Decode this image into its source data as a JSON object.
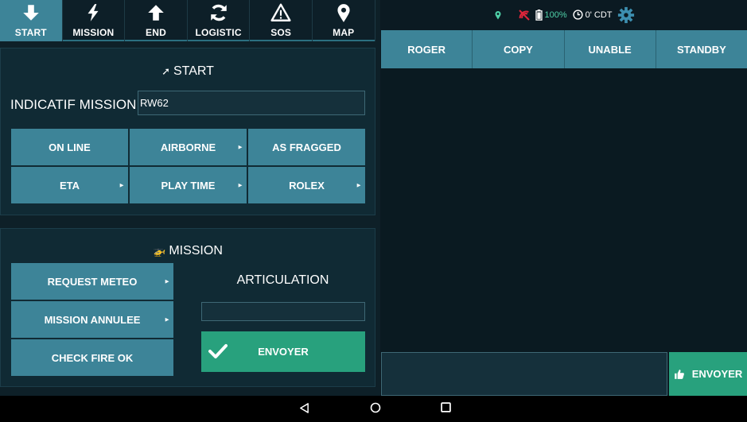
{
  "tabs": [
    {
      "label": "START",
      "icon": "arrow-down-icon"
    },
    {
      "label": "MISSION",
      "icon": "lightning-icon"
    },
    {
      "label": "END",
      "icon": "arrow-up-icon"
    },
    {
      "label": "LOGISTIC",
      "icon": "refresh-icon"
    },
    {
      "label": "SOS",
      "icon": "warning-icon"
    },
    {
      "label": "MAP",
      "icon": "map-pin-icon"
    }
  ],
  "active_tab": "START",
  "start": {
    "title": "START",
    "callsign_label": "INDICATIF MISSION",
    "callsign_value": "RW62",
    "buttons": [
      "ON LINE",
      "AIRBORNE",
      "AS FRAGGED",
      "ETA",
      "PLAY TIME",
      "ROLEX"
    ]
  },
  "mission": {
    "title": "MISSION",
    "buttons": [
      "REQUEST METEO",
      "MISSION ANNULEE",
      "CHECK FIRE OK"
    ],
    "articulation_label": "ARTICULATION",
    "articulation_value": "",
    "send_label": "ENVOYER"
  },
  "status": {
    "battery": "100%",
    "timer": "0'",
    "timezone": "CDT"
  },
  "quick_replies": [
    "ROGER",
    "COPY",
    "UNABLE",
    "STANDBY"
  ],
  "compose": {
    "value": "",
    "send_label": "ENVOYER"
  },
  "colors": {
    "accent": "#3d8498",
    "send": "#28a17d",
    "status": "#4fd1a8",
    "alert": "#e0253a"
  }
}
